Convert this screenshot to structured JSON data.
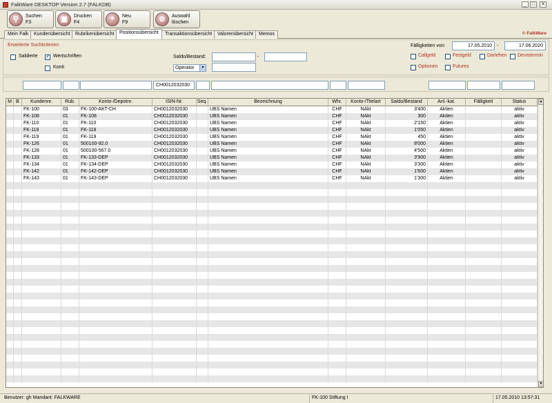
{
  "window": {
    "title": "FalkWare DESKTOP Version 2.7   (FALKDB)",
    "min": "_",
    "max": "□",
    "close": "✕"
  },
  "toolbar": {
    "search": {
      "l1": "Suchen",
      "l2": "F3",
      "icon": "magnifier-icon"
    },
    "print": {
      "l1": "Drucken",
      "l2": "F4",
      "icon": "print-icon"
    },
    "new": {
      "l1": "Neu",
      "l2": "F9",
      "icon": "plus-icon"
    },
    "clear": {
      "l1": "Auswahl",
      "l2": "löschen",
      "icon": "eraser-icon"
    }
  },
  "tabs": [
    "Mein Falk",
    "Kundenübersicht",
    "Rubrikenübersicht",
    "Positionsübersicht",
    "Transaktionsübersicht",
    "Valorenübersicht",
    "Memos"
  ],
  "brand": "© FalkWare",
  "criteria": {
    "header": "Erweiterte Suchkriterien",
    "saldierte": "Saldierte",
    "wertschriften": "Wertschriften",
    "konti": "Konti",
    "saldo_label": "Saldo/Bestand:",
    "range_dash": "-",
    "operator": "Operator",
    "faelligkeit_label": "Fälligkeiten von:",
    "date_from": "17.05.2010",
    "date_to": "17.06.2020",
    "callgeld": "Callgeld",
    "festgeld": "Festgeld",
    "darlehen": "Darlehen",
    "devistermin": "Devistermin",
    "optionen": "Optionen",
    "futures": "Futures"
  },
  "filter": {
    "isin": "CH0012032030"
  },
  "grid": {
    "columns": [
      "M",
      "B",
      "Kundennr.",
      "Rub.",
      "Konto-/Depotnr.",
      "ISIN-Nr.",
      "Seq.",
      "Bezeichnung",
      "Whr.",
      "Konto-/Titelart",
      "Saldo/Bestand",
      "Anl.-kat.",
      "Fälligkeit",
      "Status"
    ],
    "rows": [
      [
        "",
        "",
        "FK-100",
        "03",
        "FK-100-AKT-CH",
        "CH0012032030",
        "",
        "UBS Namen",
        "CHF",
        "NAkt",
        "3'400",
        "Aktien",
        "",
        "aktiv"
      ],
      [
        "",
        "",
        "FK-108",
        "01",
        "FK-108",
        "CH0012032030",
        "",
        "UBS Namen",
        "CHF",
        "NAkt",
        "300",
        "Aktien",
        "",
        "aktiv"
      ],
      [
        "",
        "",
        "FK-110",
        "01",
        "FK-110",
        "CH0012032030",
        "",
        "UBS Namen",
        "CHF",
        "NAkt",
        "2'150",
        "Aktien",
        "",
        "aktiv"
      ],
      [
        "",
        "",
        "FK-118",
        "01",
        "FK-118",
        "CH0012032030",
        "",
        "UBS Namen",
        "CHF",
        "NAkt",
        "1'050",
        "Aktien",
        "",
        "aktiv"
      ],
      [
        "",
        "",
        "FK-119",
        "01",
        "FK-119",
        "CH0012032030",
        "",
        "UBS Namen",
        "CHF",
        "NAkt",
        "450",
        "Aktien",
        "",
        "aktiv"
      ],
      [
        "",
        "",
        "FK-126",
        "01",
        "500100-92.0",
        "CH0012032030",
        "",
        "UBS Namen",
        "CHF",
        "NAkt",
        "8'000",
        "Aktien",
        "",
        "aktiv"
      ],
      [
        "",
        "",
        "FK-128",
        "01",
        "500100-567.0",
        "CH0012032030",
        "",
        "UBS Namen",
        "CHF",
        "NAkt",
        "4'500",
        "Aktien",
        "",
        "aktiv"
      ],
      [
        "",
        "",
        "FK-133",
        "01",
        "FK-133-DEP",
        "CH0012032030",
        "",
        "UBS Namen",
        "CHF",
        "NAkt",
        "3'900",
        "Aktien",
        "",
        "aktiv"
      ],
      [
        "",
        "",
        "FK-134",
        "01",
        "FK-134-DEP",
        "CH0012032030",
        "",
        "UBS Namen",
        "CHF",
        "NAkt",
        "3'300",
        "Aktien",
        "",
        "aktiv"
      ],
      [
        "",
        "",
        "FK-142",
        "01",
        "FK-142-DEP",
        "CH0012032030",
        "",
        "UBS Namen",
        "CHF",
        "NAkt",
        "1'600",
        "Aktien",
        "",
        "aktiv"
      ],
      [
        "",
        "",
        "FK-143",
        "01",
        "FK-143-DEP",
        "CH0012032030",
        "",
        "UBS Namen",
        "CHF",
        "NAkt",
        "1'300",
        "Aktien",
        "",
        "aktiv"
      ]
    ]
  },
  "status": {
    "user": "Benutzer: gh  Mandant: FALKWARE",
    "client": "FK-100  Stiftung I",
    "datetime": "17.05.2010 13:57:31"
  }
}
